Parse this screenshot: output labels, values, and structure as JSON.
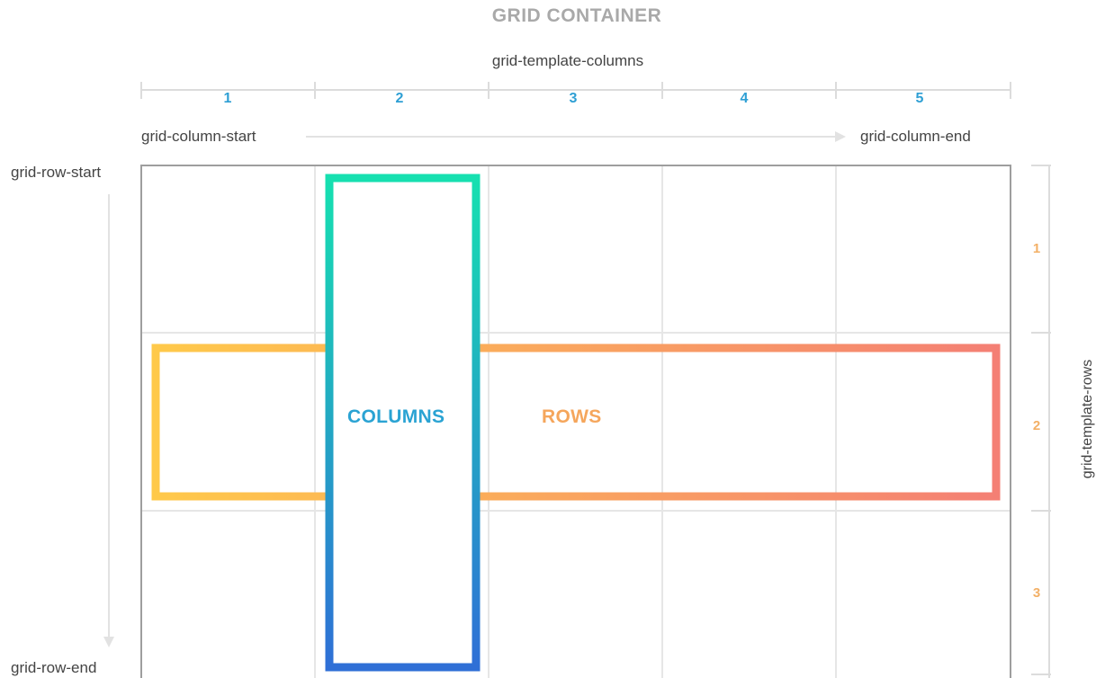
{
  "title": "GRID CONTAINER",
  "grid_template_columns_label": "grid-template-columns",
  "grid_template_rows_label": "grid-template-rows",
  "column_start_label": "grid-column-start",
  "column_end_label": "grid-column-end",
  "row_start_label": "grid-row-start",
  "row_end_label": "grid-row-end",
  "column_numbers": [
    "1",
    "2",
    "3",
    "4",
    "5"
  ],
  "row_numbers": [
    "1",
    "2",
    "3"
  ],
  "columns_box_label": "COLUMNS",
  "rows_box_label": "ROWS",
  "colors": {
    "column_number": "#2e9fd4",
    "row_number": "#f3b066",
    "columns_gradient_top": "#16e0b0",
    "columns_gradient_bottom": "#2f6fd6",
    "rows_gradient_left": "#ffc94a",
    "rows_gradient_right": "#f47f74",
    "grid_line": "#e6e6e6",
    "container_border": "#9e9e9e"
  }
}
